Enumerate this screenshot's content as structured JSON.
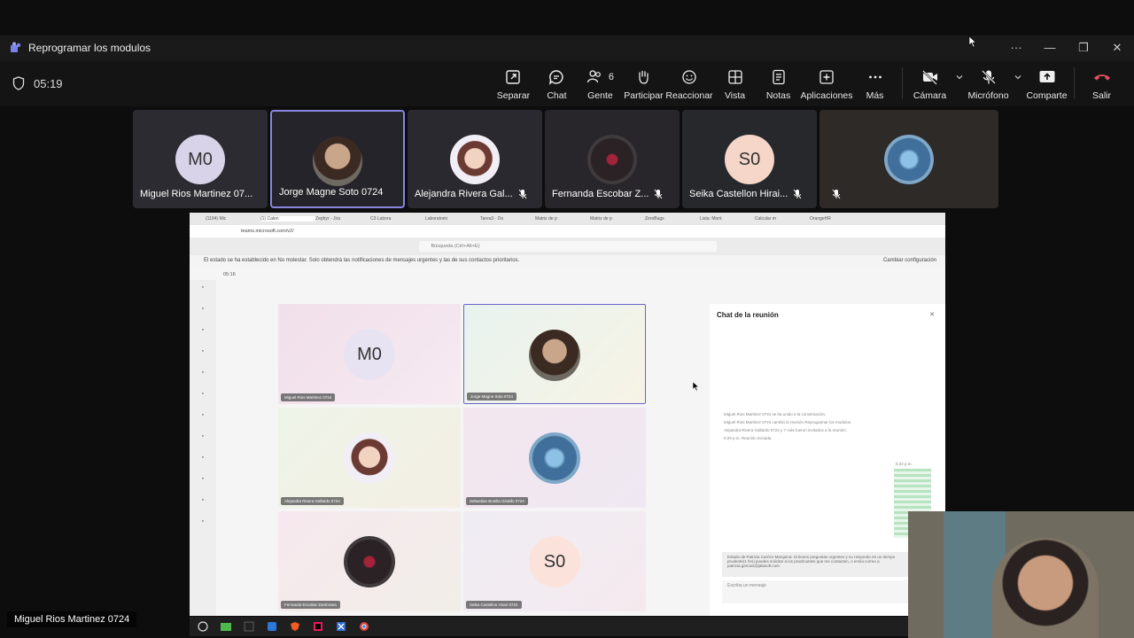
{
  "window": {
    "title": "Reprogramar los modulos",
    "min": "—",
    "max": "❐",
    "close": "✕",
    "more": "···"
  },
  "call": {
    "timer": "05:19"
  },
  "toolbar": [
    {
      "label": "Separar",
      "icon": "popout-icon"
    },
    {
      "label": "Chat",
      "icon": "chat-icon"
    },
    {
      "label": "Gente",
      "icon": "people-icon",
      "badge": "6"
    },
    {
      "label": "Participar",
      "icon": "raise-hand-icon"
    },
    {
      "label": "Reaccionar",
      "icon": "react-icon"
    },
    {
      "label": "Vista",
      "icon": "view-icon"
    },
    {
      "label": "Notas",
      "icon": "notes-icon"
    },
    {
      "label": "Aplicaciones",
      "icon": "apps-icon"
    },
    {
      "label": "Más",
      "icon": "more-icon"
    },
    {
      "label": "Cámara",
      "icon": "camera-off-icon"
    },
    {
      "label": "Micrófono",
      "icon": "mic-off-icon"
    },
    {
      "label": "Comparte",
      "icon": "share-icon"
    },
    {
      "label": "Salir",
      "icon": "leave-icon"
    }
  ],
  "participants": [
    {
      "name": "Miguel Rios Martinez 07...",
      "initials": "M0",
      "color": "#d8d3e8",
      "muted": false
    },
    {
      "name": "Jorge Magne Soto 0724",
      "initials": "",
      "color": "#6e5a4a",
      "muted": false
    },
    {
      "name": "Alejandra Rivera Gal...",
      "initials": "",
      "color": "#e6e1f0",
      "muted": true
    },
    {
      "name": "Fernanda Escobar Z...",
      "initials": "",
      "color": "#3a2c30",
      "muted": true
    },
    {
      "name": "Seika Castellon Hirai...",
      "initials": "S0",
      "color": "#f5d6c8",
      "muted": true
    },
    {
      "name": "",
      "initials": "",
      "color": "#5f8fb8",
      "muted": true
    }
  ],
  "browser": {
    "tabs": [
      "(1194) Mic",
      "(1) Calen",
      "Zephyr - Jira",
      "C3 Labora",
      "Laboratorio",
      "Tarea3 - Do",
      "Matriz de p",
      "Matriz de p",
      "ZeroBugs",
      "Lista: Mont",
      "Calcular m",
      "OrangeHR"
    ],
    "url": "teams.microsoft.com/v2/",
    "search": "Búsqueda (Ctrl+Alt+E)",
    "notice": "El estado se ha establecido en No molestar. Solo obtendrá las notificaciones de mensajes urgentes y las de sus contactos prioritarios.",
    "notice_action": "Cambiar configuración",
    "inner_timer": "05:16"
  },
  "inner_grid": [
    {
      "name": "Miguel Rios Martinez 0724",
      "initials": "M0"
    },
    {
      "name": "Jorge Magne Soto 0724",
      "initials": ""
    },
    {
      "name": "Alejandra Rivera Gallardo 0724",
      "initials": ""
    },
    {
      "name": "Sebastian Bonilla Giraldo 0724",
      "initials": ""
    },
    {
      "name": "Fernanda Escobar Zambrana",
      "initials": ""
    },
    {
      "name": "Seika Castellon Hiran 0724",
      "initials": "S0"
    }
  ],
  "chat": {
    "title": "Chat de la reunión",
    "events": [
      "Miguel Rios Martinez 0724 se ha unido a la conversación.",
      "Miguel Rios Martinez 0724 cambió la reunión Reprogramar los modulos.",
      "Alejandra Rivera Gallardo 0724 y 7 más fueron invitados a la reunión.",
      "5:29 p.m.   Reunión iniciada"
    ],
    "status_msg": "Estado de Patricia Carrizo Marquina: Si tienes preguntas urgentes y no respondo en un tiempo prudente(1 hrs) puedes solicitar a los practicantes que me contacten, o envía correo a patricia.garcias@jalasoft.com",
    "placeholder": "Escriba un mensaje",
    "time": "5:32 p.m."
  },
  "self_name": "Miguel Rios Martinez 0724"
}
